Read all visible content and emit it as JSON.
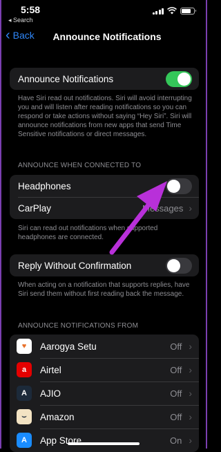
{
  "status_bar": {
    "time": "5:58",
    "back_to_app": "◂ Search"
  },
  "nav": {
    "back_label": "Back",
    "title": "Announce Notifications"
  },
  "main_toggle": {
    "label": "Announce Notifications",
    "on": true
  },
  "main_footer": "Have Siri read out notifications. Siri will avoid interrupting you and will listen after reading notifications so you can respond or take actions without saying “Hey Siri”. Siri will announce notifications from new apps that send Time Sensitive notifications or direct messages.",
  "connected_section": {
    "header": "ANNOUNCE WHEN CONNECTED TO",
    "headphones_label": "Headphones",
    "headphones_on": false,
    "carplay_label": "CarPlay",
    "carplay_value": "Messages",
    "footer": "Siri can read out notifications when supported headphones are connected."
  },
  "reply_section": {
    "label": "Reply Without Confirmation",
    "on": false,
    "footer": "When acting on a notification that supports replies, have Siri send them without first reading back the message."
  },
  "apps_section": {
    "header": "ANNOUNCE NOTIFICATIONS FROM",
    "apps": [
      {
        "name": "Aarogya Setu",
        "value": "Off",
        "icon": "heart-icon",
        "icon_bg": "#ffffff",
        "icon_fg": "#e8712b",
        "glyph": "♥"
      },
      {
        "name": "Airtel",
        "value": "Off",
        "icon": "airtel-icon",
        "icon_bg": "#e40000",
        "icon_fg": "#ffffff",
        "glyph": "a"
      },
      {
        "name": "AJIO",
        "value": "Off",
        "icon": "ajio-icon",
        "icon_bg": "#1c2a3a",
        "icon_fg": "#ffffff",
        "glyph": "A"
      },
      {
        "name": "Amazon",
        "value": "Off",
        "icon": "amazon-icon",
        "icon_bg": "#f3e3c3",
        "icon_fg": "#232f3e",
        "glyph": "⌣"
      },
      {
        "name": "App Store",
        "value": "On",
        "icon": "app-store-icon",
        "icon_bg": "#1a8cff",
        "icon_fg": "#ffffff",
        "glyph": "A"
      }
    ]
  },
  "colors": {
    "accent_blue": "#2f86f7",
    "toggle_on": "#34c759",
    "annotation_arrow": "#b830d9"
  }
}
